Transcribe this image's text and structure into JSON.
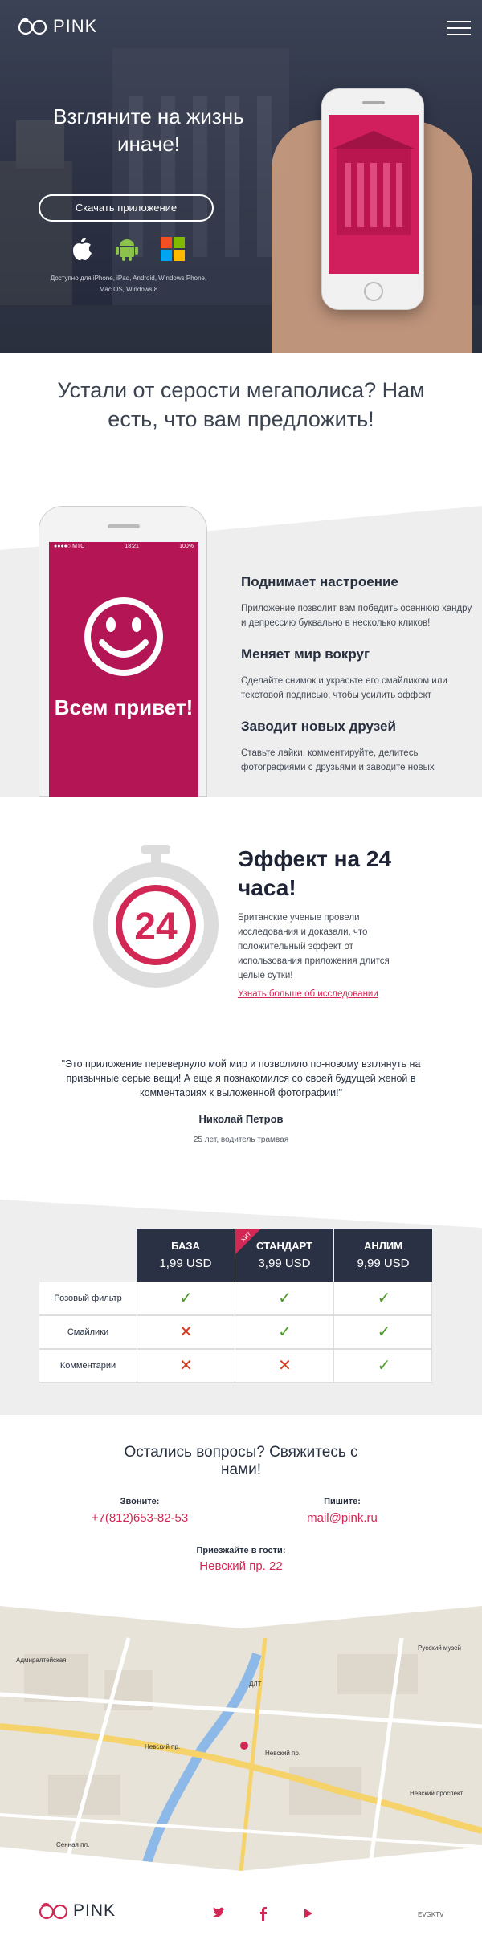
{
  "brand": {
    "logo_text": "PINK",
    "accent": "#d22856",
    "dark": "#2b3144"
  },
  "hero": {
    "title": "Взгляните на жизнь иначе!",
    "download_button": "Скачать приложение",
    "platforms": [
      "apple-icon",
      "android-icon",
      "windows-icon"
    ],
    "available_text": "Доступно для iPhone, iPad, Android, Windows Phone, Mac OS, Windows 8"
  },
  "intro": {
    "title": "Устали от серости мегаполиса? Нам есть, что вам предложить!"
  },
  "features": {
    "phone_status_left": "●●●●○ MTC",
    "phone_status_time": "18:21",
    "phone_status_right": "100%",
    "screen_text": "Всем привет!",
    "items": [
      {
        "title": "Поднимает настроение",
        "text": "Приложение позволит вам победить осеннюю хандру и депрессию буквально в несколько кликов!"
      },
      {
        "title": "Меняет мир вокруг",
        "text": "Сделайте снимок и украсьте его смайликом или текстовой подписью, чтобы усилить эффект"
      },
      {
        "title": "Заводит новых друзей",
        "text": "Ставьте лайки, комментируйте, делитесь фотографиями с друзьями и заводите новых"
      }
    ]
  },
  "effect": {
    "timer_value": "24",
    "title": "Эффект на 24 часа!",
    "text": "Британские ученые провели исследования и доказали, что положительный эффект от использования приложения длится целые сутки!",
    "link": "Узнать больше об исследовании"
  },
  "testimonial": {
    "quote": "\"Это приложение перевернуло мой мир и позволило по-новому взглянуть на привычные серые вещи! А еще я познакомился со своей будущей женой в комментариях к выложенной фотографии!\"",
    "author": "Николай Петров",
    "position": "25 лет, водитель трамвая"
  },
  "prices": {
    "hit_label": "ХИТ",
    "plans": [
      {
        "name": "БАЗА",
        "price": "1,99 USD"
      },
      {
        "name": "СТАНДАРТ",
        "price": "3,99 USD"
      },
      {
        "name": "АНЛИМ",
        "price": "9,99 USD"
      }
    ],
    "rows": [
      {
        "label": "Розовый фильтр",
        "cells": [
          "✓",
          "✓",
          "✓"
        ],
        "available": [
          true,
          true,
          true
        ]
      },
      {
        "label": "Смайлики",
        "cells": [
          "✕",
          "✓",
          "✓"
        ],
        "available": [
          false,
          true,
          true
        ]
      },
      {
        "label": "Комментарии",
        "cells": [
          "✕",
          "✕",
          "✓"
        ],
        "available": [
          false,
          false,
          true
        ]
      }
    ]
  },
  "contacts": {
    "title": "Остались вопросы? Свяжитесь с нами!",
    "phone_label": "Звоните:",
    "phone": "+7(812)653-82-53",
    "email_label": "Пишите:",
    "email": "mail@pink.ru",
    "address_label": "Приезжайте в гости:",
    "address": "Невский пр. 22"
  },
  "map": {
    "labels": [
      "Невский пр.",
      "Невский пр.",
      "Невский проспект",
      "Адмиралтейская",
      "Сенная пл.",
      "ДЛТ",
      "Русский музей"
    ]
  },
  "footer": {
    "social": [
      "twitter-icon",
      "facebook-icon",
      "youtube-icon"
    ],
    "credits": "EVGKTV"
  }
}
